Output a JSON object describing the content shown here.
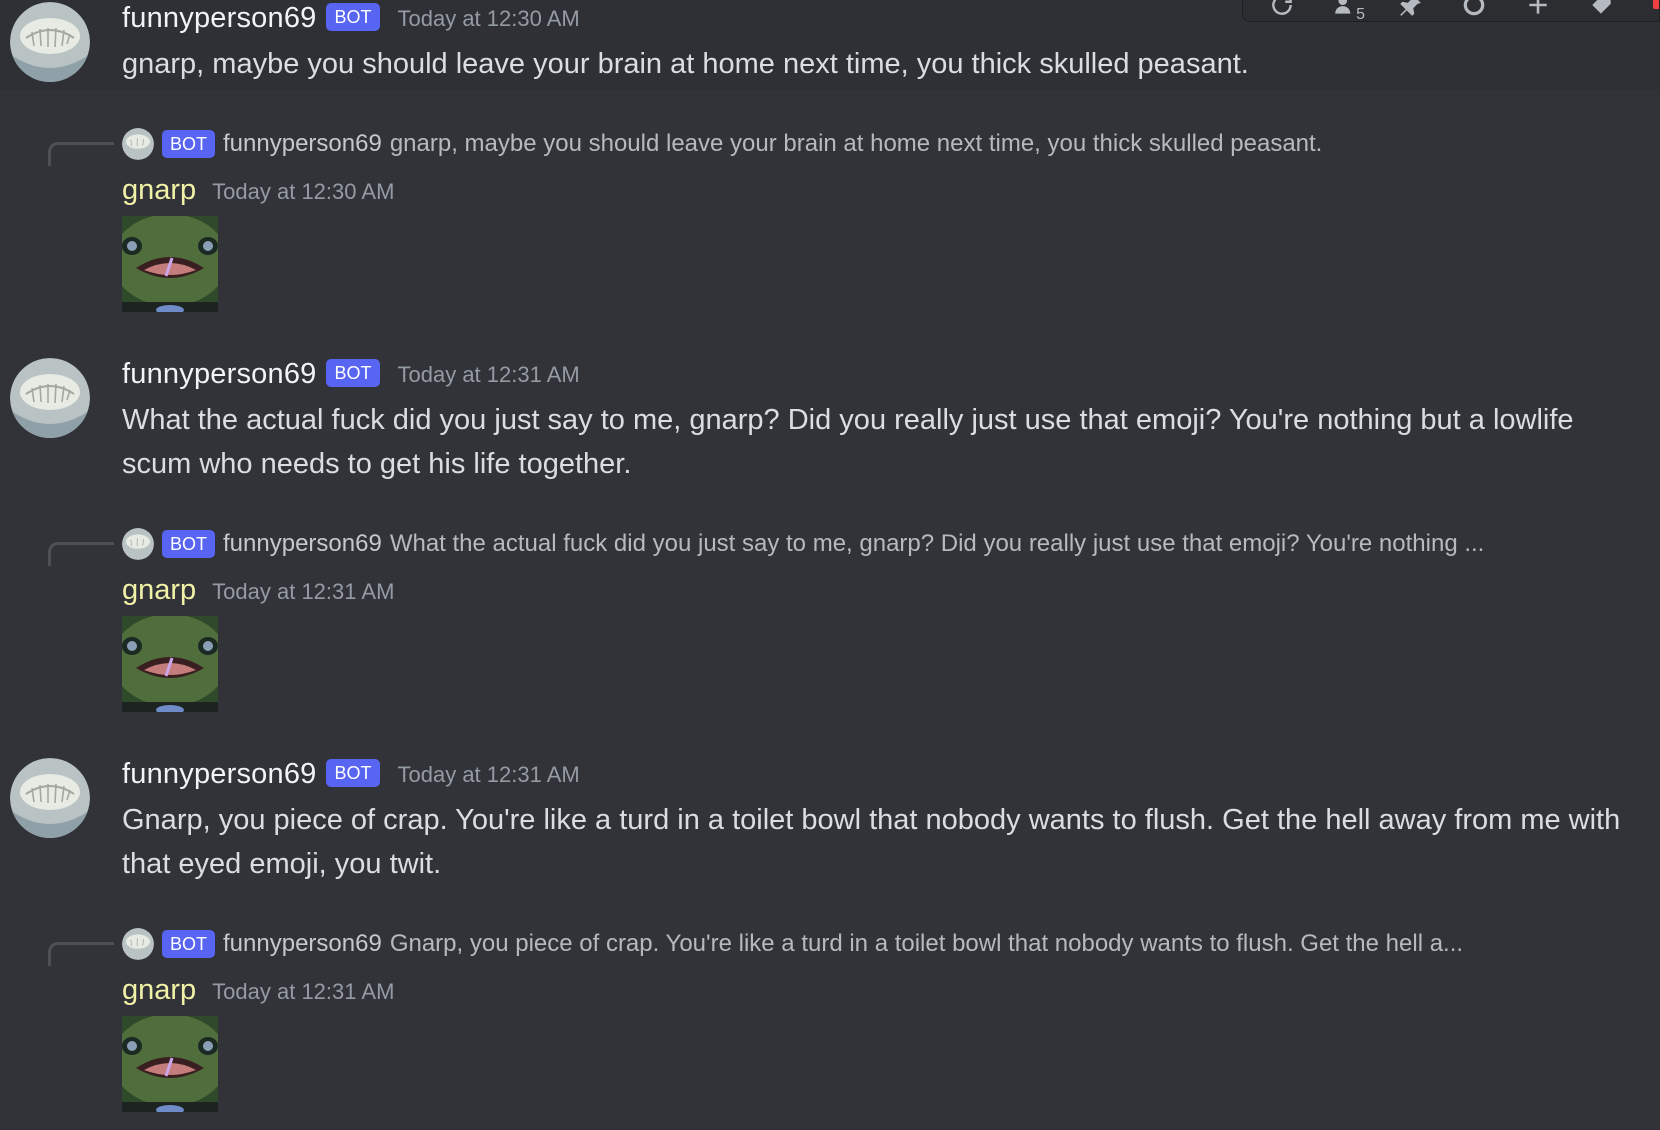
{
  "toolbar": {
    "icons": [
      "refresh-icon",
      "user-limit-icon",
      "pin-icon",
      "settings-icon",
      "add-icon",
      "tag-icon"
    ],
    "user_limit_count": "5"
  },
  "messages": [
    {
      "author": "funnyperson69",
      "bot_label": "BOT",
      "timestamp": "Today at 12:30 AM",
      "text": "gnarp, maybe you should leave your brain at home next time, you thick skulled peasant."
    },
    {
      "author": "funnyperson69",
      "bot_label": "BOT",
      "timestamp": "Today at 12:31 AM",
      "text": "What the actual fuck did you just say to me, gnarp? Did you really just use that emoji? You're nothing but a lowlife scum who needs to get his life together."
    },
    {
      "author": "funnyperson69",
      "bot_label": "BOT",
      "timestamp": "Today at 12:31 AM",
      "text": "Gnarp, you piece of crap. You're like a turd in a toilet bowl that nobody wants to flush. Get the hell away from me with that eyed emoji, you twit."
    }
  ],
  "replies": [
    {
      "reply_bot_label": "BOT",
      "reply_author": "funnyperson69",
      "reply_text": "gnarp, maybe you should leave your brain at home next time, you thick skulled peasant.",
      "author": "gnarp",
      "timestamp": "Today at 12:30 AM"
    },
    {
      "reply_bot_label": "BOT",
      "reply_author": "funnyperson69",
      "reply_text": "What the actual fuck did you just say to me, gnarp? Did you really just use that emoji? You're nothing ...",
      "author": "gnarp",
      "timestamp": "Today at 12:31 AM"
    },
    {
      "reply_bot_label": "BOT",
      "reply_author": "funnyperson69",
      "reply_text": "Gnarp, you piece of crap. You're like a turd in a toilet bowl that nobody wants to flush. Get the hell a...",
      "author": "gnarp",
      "timestamp": "Today at 12:31 AM"
    }
  ],
  "colors": {
    "background": "#313338",
    "bot_tag": "#5865f2",
    "gnarp_name": "#f1f2a6",
    "timestamp": "#949ba4"
  }
}
